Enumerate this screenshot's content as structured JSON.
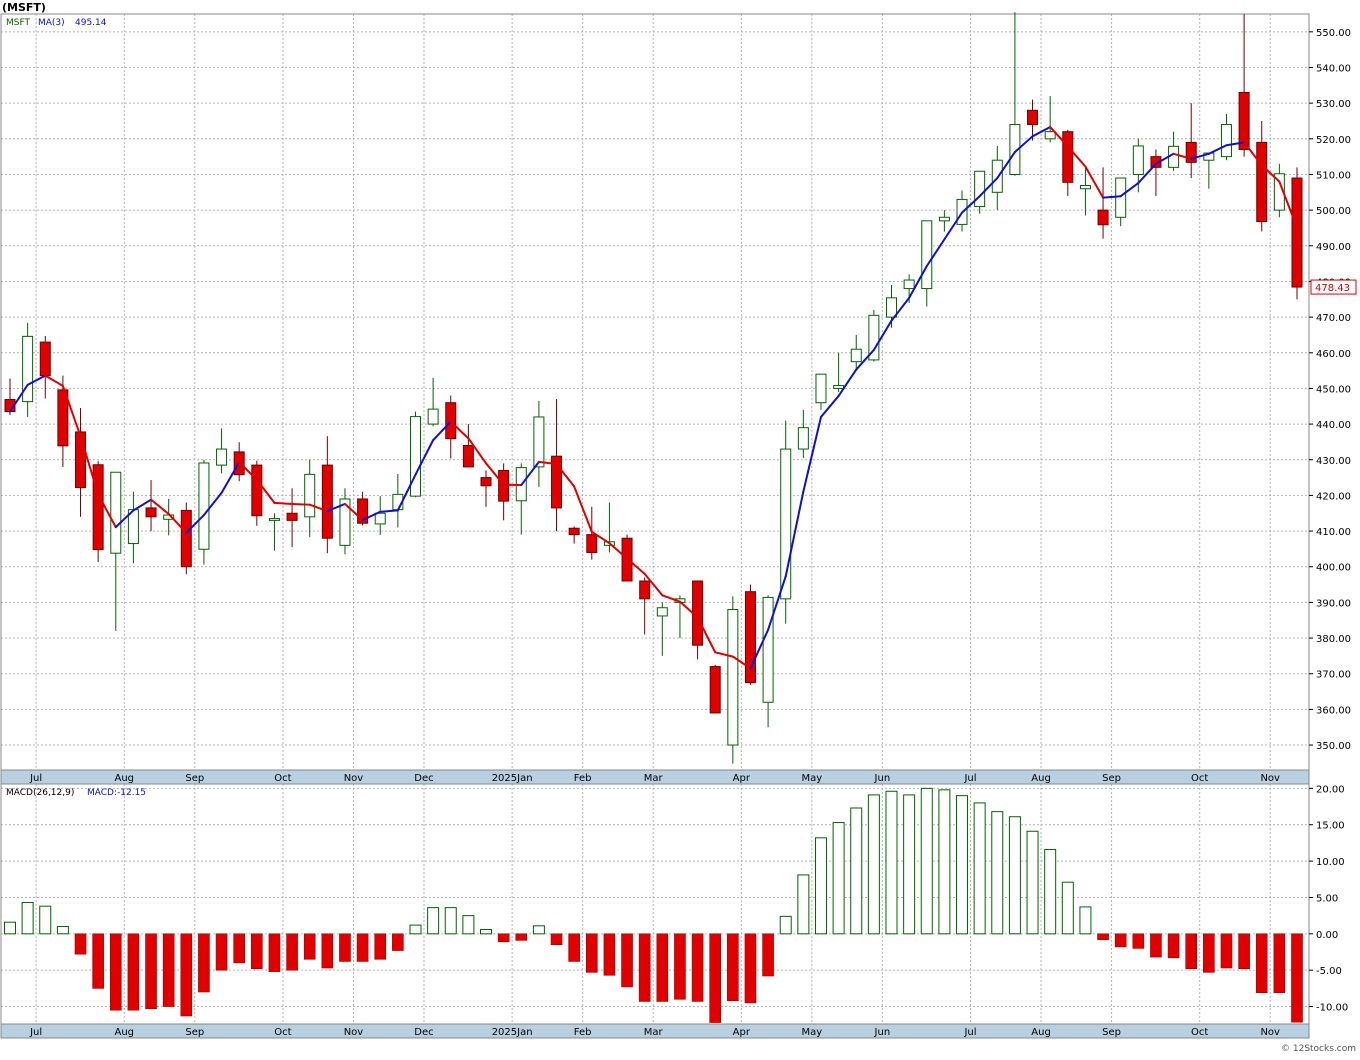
{
  "header": {
    "symbol_title": "(MSFT)"
  },
  "footer": {
    "copyright": "© 12Stocks.com"
  },
  "colors": {
    "up_candle": "#006400",
    "down_candle": "#e00000",
    "ma_up": "#1010d0",
    "ma_down": "#e00000",
    "grid": "#b4b4b4",
    "axis_band": "#b8d0e0",
    "price_tag_border": "#e00000"
  },
  "price_panel": {
    "legend_symbol": "MSFT",
    "legend_ma": "MA(3)",
    "legend_ma_value": "495.14",
    "last_price_label": "478.43"
  },
  "macd_panel": {
    "legend_label": "MACD(26,12,9)",
    "legend_value": "MACD:-12.15"
  },
  "chart_data": [
    {
      "type": "candlestick",
      "title": "(MSFT)",
      "period": "weekly",
      "x_tick_labels": [
        "Jul",
        "Aug",
        "Sep",
        "Oct",
        "Nov",
        "Dec",
        "2025Jan",
        "Feb",
        "Mar",
        "Apr",
        "May",
        "Jun",
        "Jul",
        "Aug",
        "Sep",
        "Oct",
        "Nov"
      ],
      "x_tick_week_index": [
        1,
        6,
        10,
        15,
        19,
        23,
        28,
        32,
        36,
        41,
        45,
        49,
        54,
        58,
        62,
        67,
        71
      ],
      "ylim": [
        343,
        555
      ],
      "y_ticks": [
        350,
        360,
        370,
        380,
        390,
        400,
        410,
        420,
        430,
        440,
        450,
        460,
        470,
        480,
        490,
        500,
        510,
        520,
        530,
        540,
        550
      ],
      "y_tick_labels": [
        "350.00",
        "360.00",
        "370.00",
        "380.00",
        "390.00",
        "400.00",
        "410.00",
        "420.00",
        "430.00",
        "440.00",
        "450.00",
        "460.00",
        "470.00",
        "480.00",
        "490.00",
        "500.00",
        "510.00",
        "520.00",
        "530.00",
        "540.00",
        "550.00"
      ],
      "grid": true,
      "last_price": 478.43,
      "ohlc": [
        [
          446.9,
          452.8,
          442.5,
          443.5
        ],
        [
          446.3,
          468.4,
          442.0,
          464.6
        ],
        [
          463.0,
          464.7,
          447.2,
          453.6
        ],
        [
          449.6,
          453.6,
          428.0,
          433.9
        ],
        [
          437.8,
          444.5,
          414.0,
          422.2
        ],
        [
          428.6,
          429.6,
          401.3,
          404.8
        ],
        [
          403.8,
          411.6,
          382.0,
          426.5
        ],
        [
          406.5,
          421.0,
          401.0,
          416.0
        ],
        [
          416.5,
          424.3,
          410.0,
          414.0
        ],
        [
          413.3,
          419.0,
          408.8,
          414.5
        ],
        [
          415.8,
          418.0,
          397.9,
          400.0
        ],
        [
          404.9,
          430.0,
          400.6,
          429.1
        ],
        [
          428.5,
          438.8,
          426.2,
          433.0
        ],
        [
          432.2,
          434.9,
          424.0,
          425.8
        ],
        [
          428.5,
          429.7,
          411.5,
          414.3
        ],
        [
          413.0,
          415.0,
          404.5,
          413.5
        ],
        [
          415.0,
          422.0,
          405.5,
          413.0
        ],
        [
          414.0,
          430.0,
          408.3,
          425.9
        ],
        [
          428.5,
          436.6,
          403.8,
          408.0
        ],
        [
          406.0,
          422.0,
          403.5,
          419.0
        ],
        [
          419.0,
          421.0,
          411.6,
          412.2
        ],
        [
          412.0,
          419.8,
          408.9,
          415.0
        ],
        [
          416.0,
          426.0,
          411.0,
          420.3
        ],
        [
          419.8,
          443.5,
          419.5,
          442.1
        ],
        [
          440.0,
          453.0,
          439.4,
          444.2
        ],
        [
          446.0,
          448.0,
          430.4,
          435.9
        ],
        [
          434.0,
          440.0,
          428.0,
          428.0
        ],
        [
          425.0,
          427.0,
          416.8,
          422.7
        ],
        [
          427.0,
          429.0,
          413.0,
          418.4
        ],
        [
          418.5,
          429.0,
          409.0,
          427.8
        ],
        [
          428.0,
          446.5,
          422.4,
          442.0
        ],
        [
          431.0,
          447.0,
          410.0,
          416.5
        ],
        [
          410.8,
          411.3,
          406.5,
          409.0
        ],
        [
          409.0,
          416.8,
          402.0,
          404.0
        ],
        [
          406.0,
          418.0,
          404.0,
          407.0
        ],
        [
          408.0,
          409.0,
          396.0,
          396.0
        ],
        [
          396.0,
          397.0,
          381.0,
          391.0
        ],
        [
          386.2,
          390.0,
          375.0,
          388.5
        ],
        [
          390.0,
          392.0,
          380.0,
          391.0
        ],
        [
          396.0,
          394.5,
          374.0,
          378.0
        ],
        [
          372.0,
          372.5,
          359.0,
          359.0
        ],
        [
          350.0,
          391.7,
          344.8,
          388.0
        ],
        [
          393.0,
          395.0,
          366.9,
          367.5
        ],
        [
          362.0,
          392.0,
          355.0,
          391.4
        ],
        [
          391.0,
          441.0,
          384.0,
          433.0
        ],
        [
          433.0,
          444.0,
          430.5,
          439.0
        ],
        [
          446.0,
          454.0,
          444.0,
          454.0
        ],
        [
          450.0,
          460.0,
          449.0,
          450.8
        ],
        [
          457.5,
          465.0,
          455.0,
          461.0
        ],
        [
          458.0,
          472.0,
          457.5,
          470.5
        ],
        [
          470.0,
          479.0,
          467.0,
          475.4
        ],
        [
          478.0,
          482.0,
          474.0,
          480.4
        ],
        [
          478.0,
          493.0,
          473.0,
          497.0
        ],
        [
          497.0,
          500.0,
          494.0,
          498.0
        ],
        [
          496.0,
          505.5,
          494.0,
          503.0
        ],
        [
          501.0,
          511.0,
          499.0,
          510.9
        ],
        [
          505.0,
          518.0,
          500.0,
          514.0
        ],
        [
          510.0,
          555.5,
          509.6,
          524.0
        ],
        [
          528.0,
          531.0,
          519.5,
          524.0
        ],
        [
          520.0,
          532.0,
          519.0,
          522.0
        ],
        [
          522.0,
          522.5,
          504.0,
          507.8
        ],
        [
          506.0,
          512.0,
          498.5,
          506.9
        ],
        [
          500.0,
          512.0,
          492.0,
          495.9
        ],
        [
          498.0,
          505.0,
          495.5,
          509.0
        ],
        [
          510.0,
          520.0,
          505.0,
          518.0
        ],
        [
          515.0,
          517.0,
          504.0,
          512.0
        ],
        [
          512.0,
          522.0,
          511.0,
          517.9
        ],
        [
          519.0,
          530.0,
          509.0,
          513.4
        ],
        [
          514.0,
          515.0,
          506.0,
          516.0
        ],
        [
          515.0,
          527.0,
          514.0,
          524.0
        ],
        [
          533.0,
          555.0,
          515.0,
          517.0
        ],
        [
          519.0,
          525.0,
          494.0,
          496.8
        ],
        [
          500.0,
          513.0,
          498.0,
          510.2
        ],
        [
          509.0,
          512.0,
          475.0,
          478.43
        ]
      ],
      "ma3": [
        443.5,
        451.0,
        453.6,
        450.7,
        436.6,
        420.3,
        411.1,
        415.8,
        418.8,
        414.8,
        409.5,
        414.5,
        420.7,
        429.3,
        424.4,
        417.9,
        417.6,
        417.4,
        415.6,
        417.6,
        413.1,
        415.4,
        415.8,
        425.8,
        435.5,
        440.7,
        436.0,
        429.0,
        423.0,
        422.9,
        429.4,
        428.8,
        422.5,
        409.8,
        406.6,
        402.3,
        398.0,
        392.0,
        390.2,
        385.8,
        376.0,
        374.8,
        371.5,
        382.3,
        397.3,
        421.1,
        442.0,
        447.9,
        455.3,
        460.8,
        469.0,
        475.4,
        484.3,
        491.8,
        499.3,
        503.9,
        509.0,
        516.3,
        520.7,
        523.3,
        517.9,
        512.2,
        503.5,
        503.9,
        507.6,
        513.0,
        515.8,
        514.4,
        515.8,
        518.2,
        519.0,
        512.6,
        508.0,
        495.1
      ]
    },
    {
      "type": "bar",
      "title": "MACD(26,12,9)",
      "current_label": "MACD:-12.15",
      "ylim": [
        -12.4,
        20.6
      ],
      "y_ticks": [
        -10,
        -5,
        0,
        5,
        10,
        15,
        20
      ],
      "y_tick_labels": [
        "-10.00",
        "-5.00",
        "0.00",
        "5.00",
        "10.00",
        "15.00",
        "20.00"
      ],
      "grid": true,
      "values": [
        1.6,
        4.3,
        3.8,
        1.0,
        -2.8,
        -7.5,
        -10.5,
        -10.5,
        -10.3,
        -10.0,
        -11.3,
        -8.0,
        -5.0,
        -4.0,
        -4.8,
        -5.2,
        -5.0,
        -3.5,
        -4.7,
        -3.8,
        -3.8,
        -3.5,
        -2.3,
        1.2,
        3.6,
        3.6,
        2.5,
        0.6,
        -1.1,
        -0.9,
        1.1,
        -1.5,
        -3.8,
        -5.3,
        -5.7,
        -7.3,
        -9.3,
        -9.3,
        -9.0,
        -9.3,
        -12.2,
        -9.2,
        -9.5,
        -5.8,
        2.4,
        8.1,
        13.2,
        15.3,
        17.3,
        19.1,
        19.6,
        19.1,
        20.0,
        19.8,
        19.0,
        18.0,
        16.8,
        16.1,
        14.1,
        11.6,
        7.1,
        3.7,
        -0.8,
        -1.8,
        -2.0,
        -3.2,
        -3.3,
        -4.8,
        -5.3,
        -4.7,
        -4.8,
        -8.1,
        -8.1,
        -12.15
      ]
    }
  ]
}
